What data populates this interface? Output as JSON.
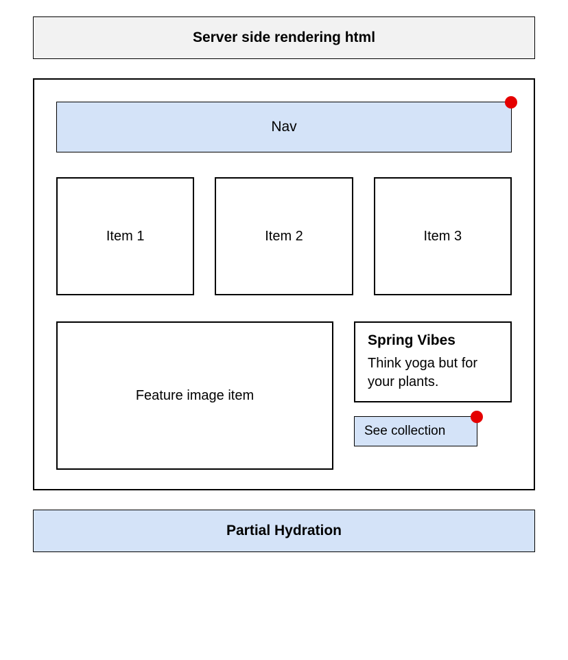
{
  "banner_top": "Server side rendering html",
  "nav": {
    "label": "Nav"
  },
  "items": [
    {
      "label": "Item 1"
    },
    {
      "label": "Item 2"
    },
    {
      "label": "Item 3"
    }
  ],
  "feature": {
    "label": "Feature image item"
  },
  "promo": {
    "title": "Spring Vibes",
    "text": "Think yoga but for your plants."
  },
  "see_collection": {
    "label": "See collection"
  },
  "banner_bottom": "Partial Hydration",
  "colors": {
    "accent_bg": "#d4e3f8",
    "dot": "#e50000",
    "grey_bg": "#f2f2f2"
  }
}
